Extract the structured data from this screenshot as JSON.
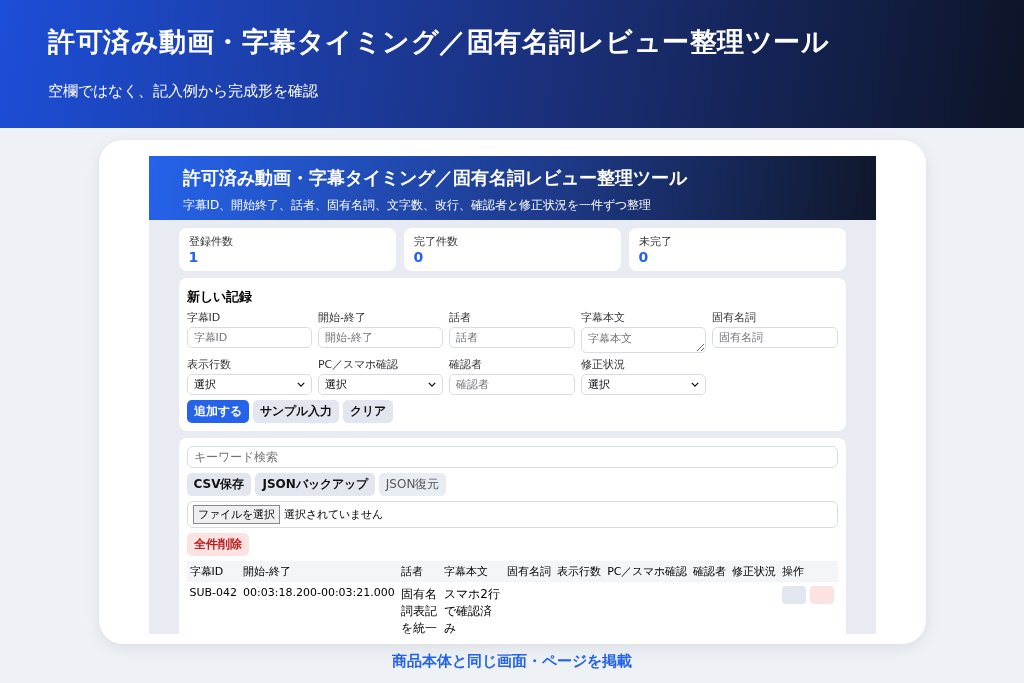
{
  "banner": {
    "title": "許可済み動画・字幕タイミング／固有名詞レビュー整理ツール",
    "subtitle": "空欄ではなく、記入例から完成形を確認"
  },
  "app": {
    "header": {
      "title": "許可済み動画・字幕タイミング／固有名詞レビュー整理ツール",
      "subtitle": "字幕ID、開始終了、話者、固有名詞、文字数、改行、確認者と修正状況を一件ずつ整理"
    },
    "stats": [
      {
        "label": "登録件数",
        "value": "1"
      },
      {
        "label": "完了件数",
        "value": "0"
      },
      {
        "label": "未完了",
        "value": "0"
      }
    ],
    "form": {
      "heading": "新しい記録",
      "fields": [
        {
          "label": "字幕ID",
          "kind": "text",
          "placeholder": "字幕ID"
        },
        {
          "label": "開始-終了",
          "kind": "text",
          "placeholder": "開始-終了"
        },
        {
          "label": "話者",
          "kind": "text",
          "placeholder": "話者"
        },
        {
          "label": "字幕本文",
          "kind": "textarea",
          "placeholder": "字幕本文"
        },
        {
          "label": "固有名詞",
          "kind": "text",
          "placeholder": "固有名詞"
        },
        {
          "label": "表示行数",
          "kind": "select",
          "value": "選択"
        },
        {
          "label": "PC／スマホ確認",
          "kind": "select",
          "value": "選択"
        },
        {
          "label": "確認者",
          "kind": "text",
          "placeholder": "確認者"
        },
        {
          "label": "修正状況",
          "kind": "select",
          "value": "選択"
        }
      ],
      "buttons": [
        {
          "label": "追加する",
          "kind": "primary"
        },
        {
          "label": "サンプル入力",
          "kind": "secondary"
        },
        {
          "label": "クリア",
          "kind": "secondary"
        }
      ]
    },
    "tools": {
      "search": {
        "placeholder": "キーワード検索"
      },
      "buttons": [
        {
          "label": "CSV保存",
          "kind": "secondary"
        },
        {
          "label": "JSONバックアップ",
          "kind": "secondary"
        },
        {
          "label": "JSON復元",
          "kind": "faded"
        }
      ],
      "file": {
        "button": "ファイルを選択",
        "status": "選択されていません"
      },
      "danger_button": "全件削除",
      "table": {
        "columns": [
          "字幕ID",
          "開始-終了",
          "話者",
          "字幕本文",
          "固有名詞",
          "表示行数",
          "PC／スマホ確認",
          "確認者",
          "修正状況",
          "操作"
        ],
        "rows": [
          {
            "cells": [
              "SUB-042",
              "00:03:18.200-00:03:21.000",
              "固有名詞表記を統一",
              "スマホ2行で確認済み",
              "",
              "",
              "",
              "",
              ""
            ],
            "actions": [
              {
                "kind": "edit"
              },
              {
                "kind": "delete"
              }
            ]
          }
        ]
      }
    }
  },
  "caption": "商品本体と同じ画面・ページを掲載"
}
